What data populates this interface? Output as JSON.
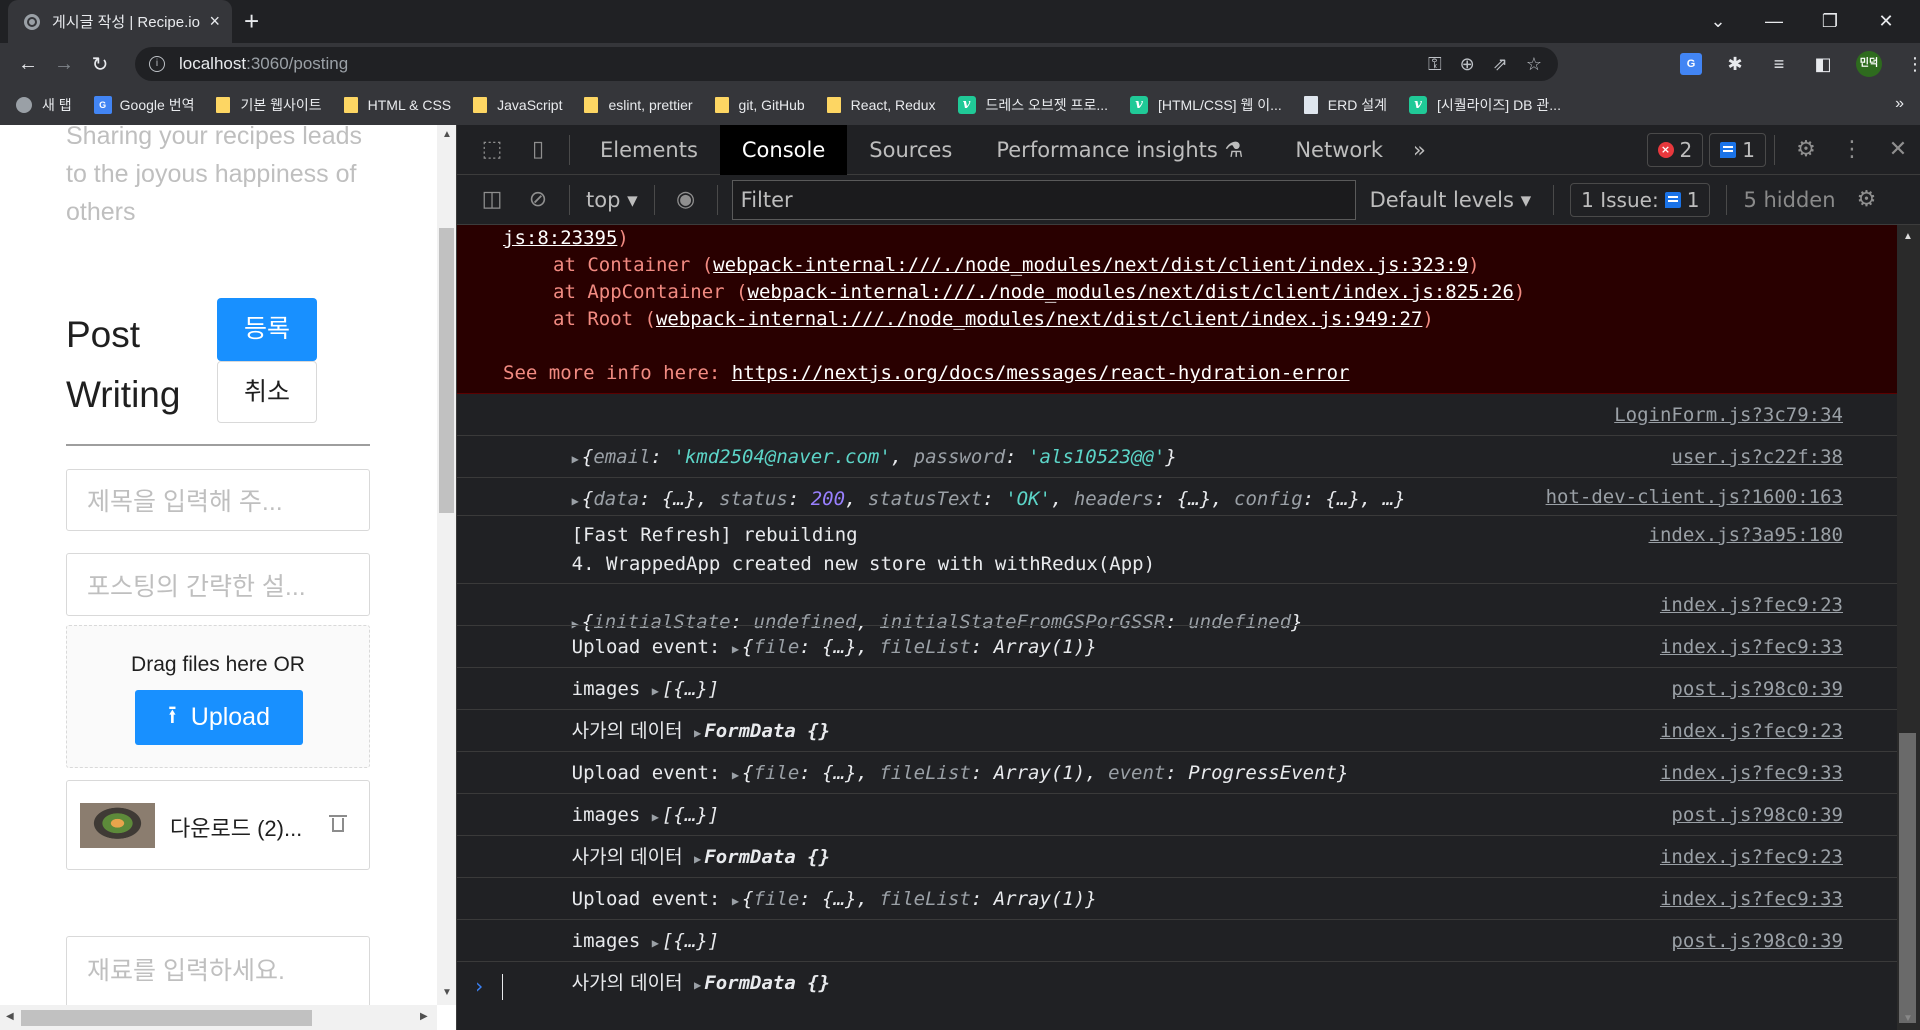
{
  "browser": {
    "tab_title": "게시글 작성 | Recipe.io",
    "tab_close": "×",
    "new_tab": "+",
    "url_host": "localhost",
    "url_path": ":3060/posting",
    "profile_initials": "민덕",
    "bookmarks": [
      {
        "icon": "globe-icon",
        "label": "새 탭"
      },
      {
        "icon": "google-translate-icon",
        "label": "Google 번역"
      },
      {
        "icon": "folder-icon",
        "label": "기본 웹사이트"
      },
      {
        "icon": "folder-icon",
        "label": "HTML & CSS"
      },
      {
        "icon": "folder-icon",
        "label": "JavaScript"
      },
      {
        "icon": "folder-icon",
        "label": "eslint, prettier"
      },
      {
        "icon": "folder-icon",
        "label": "git, GitHub"
      },
      {
        "icon": "folder-icon",
        "label": "React, Redux"
      },
      {
        "icon": "velog-icon",
        "label": "드레스 오브젯 프로..."
      },
      {
        "icon": "velog-icon",
        "label": "[HTML/CSS] 웹 이..."
      },
      {
        "icon": "document-icon",
        "label": "ERD 설계"
      },
      {
        "icon": "velog-icon",
        "label": "[시퀄라이즈] DB 관..."
      }
    ],
    "bookmarks_more": "»"
  },
  "page": {
    "tagline": "Sharing your recipes leads to the joyous happiness of others",
    "title": "Post Writing",
    "submit_label": "등록",
    "cancel_label": "취소",
    "title_placeholder": "제목을 입력해 주...",
    "desc_placeholder": "포스팅의 간략한 설...",
    "drag_text": "Drag files here OR",
    "upload_label": "Upload",
    "file_name": "다운로드 (2)...",
    "ingredients_placeholder": "재료를 입력하세요."
  },
  "devtools": {
    "tabs": [
      "Elements",
      "Console",
      "Sources",
      "Performance insights",
      "Network"
    ],
    "active_tab": "Console",
    "more_tabs": "»",
    "error_count": "2",
    "message_count": "1",
    "context": "top",
    "filter_placeholder": "Filter",
    "levels": "Default levels",
    "issues_label": "1 Issue:",
    "issues_count": "1",
    "hidden": "5 hidden",
    "error_block": {
      "line0_link": "js:8:23395",
      "stack": [
        {
          "fn": "Container",
          "link": "webpack-internal:///./node_modules/next/dist/client/index.js:323:9"
        },
        {
          "fn": "AppContainer",
          "link": "webpack-internal:///./node_modules/next/dist/client/index.js:825:26"
        },
        {
          "fn": "Root",
          "link": "webpack-internal:///./node_modules/next/dist/client/index.js:949:27"
        }
      ],
      "more_info_label": "See more info here: ",
      "more_info_link": "https://nextjs.org/docs/messages/react-hydration-error"
    },
    "logs": [
      {
        "id": "login",
        "source": "LoginForm.js?3c79:34",
        "email": "'kmd2504@naver.com'",
        "password": "'als10523@@'"
      },
      {
        "id": "user",
        "source": "user.js?c22f:38",
        "status": "200",
        "statusText": "'OK'"
      },
      {
        "id": "refresh",
        "source": "hot-dev-client.js?1600:163",
        "text": "[Fast Refresh] rebuilding"
      },
      {
        "id": "store",
        "source": "index.js?3a95:180",
        "text": "4. WrappedApp created new store with withRedux(App)",
        "initialState": "undefined",
        "initialStateFromGSPorGSSR": "undefined"
      },
      {
        "id": "upload1",
        "source": "index.js?fec9:23",
        "label": "Upload event:"
      },
      {
        "id": "images1",
        "source": "index.js?fec9:33",
        "label": "images"
      },
      {
        "id": "form1",
        "source": "post.js?98c0:39",
        "label": "사가의 데이터"
      },
      {
        "id": "upload2",
        "source": "index.js?fec9:23",
        "label": "Upload event:",
        "event": "ProgressEvent"
      },
      {
        "id": "images2",
        "source": "index.js?fec9:33",
        "label": "images"
      },
      {
        "id": "form2",
        "source": "post.js?98c0:39",
        "label": "사가의 데이터"
      },
      {
        "id": "upload3",
        "source": "index.js?fec9:23",
        "label": "Upload event:"
      },
      {
        "id": "images3",
        "source": "index.js?fec9:33",
        "label": "images"
      },
      {
        "id": "form3",
        "source": "post.js?98c0:39",
        "label": "사가의 데이터"
      }
    ],
    "prompt": "›"
  }
}
